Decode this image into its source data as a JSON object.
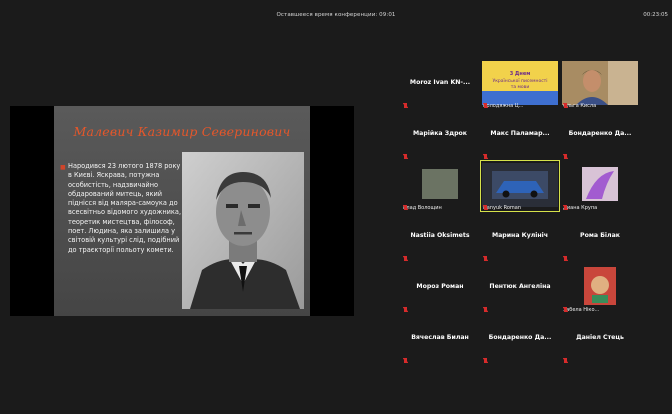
{
  "top_bar": {
    "conference_timer": "Оставшееся время конференции: 09:01",
    "clock": "00:23:05"
  },
  "slide": {
    "title": "Малевич Казимир Северинович",
    "text": "Народився 23 лютого 1878 року в Києві. Яскрава, потужна особистість, надзвичайно обдарований митець, який піднісся від маляра-самоука до всесвітньо відомого художника, теоретик мистецтва, філософ, поет. Людина, яка залишила у світовій культурі слід, подібний до траєкторії польоту комети."
  },
  "participants": [
    {
      "name": "Moroz Ivan KN-..."
    },
    {
      "name": "Колодяжна Ц...",
      "thumb": "3 Днем Української писемності та мови"
    },
    {
      "name": "Ольга Кисла"
    },
    {
      "name": "Марійка Здрок"
    },
    {
      "name": "Макс Паламар..."
    },
    {
      "name": "Бондаренко Да..."
    },
    {
      "name": "Влад Волощин"
    },
    {
      "name": "Hanyuk Roman"
    },
    {
      "name": "Диана Крупа"
    },
    {
      "name": "Nastiia Oksimets"
    },
    {
      "name": "Марина Кулініч"
    },
    {
      "name": "Рома Білак"
    },
    {
      "name": "Мороз Роман"
    },
    {
      "name": "Пентюк Ангеліна"
    },
    {
      "name": "Забела Ніко..."
    },
    {
      "name": "Вячеслав Билан"
    },
    {
      "name": "Бондаренко Да..."
    },
    {
      "name": "Даніел Стець"
    }
  ]
}
